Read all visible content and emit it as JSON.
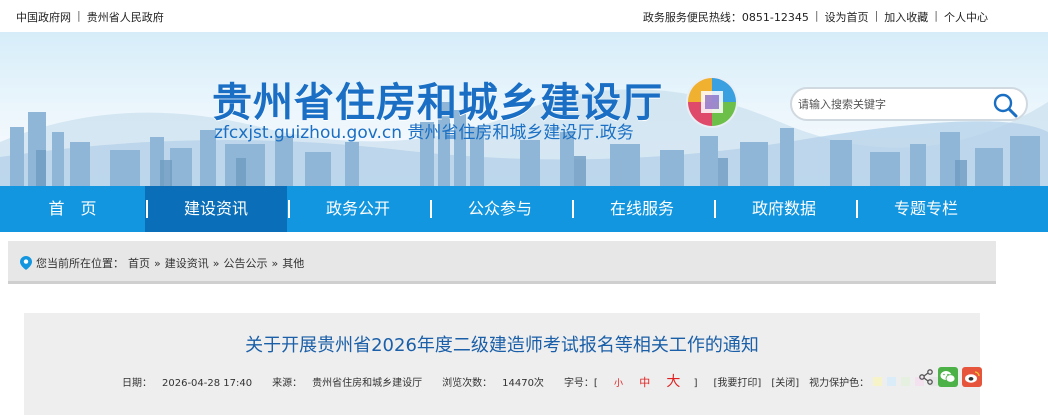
{
  "topbar": {
    "left_links": [
      "中国政府网",
      "贵州省人民政府"
    ],
    "hotline_label": "政务服务便民热线：",
    "hotline_number": "0851-12345",
    "right_links": [
      "设为首页",
      "加入收藏",
      "个人中心"
    ],
    "separator": "|"
  },
  "header": {
    "title": "贵州省住房和城乡建设厅",
    "subtitle": "zfcxjst.guizhou.gov.cn 贵州省住房和城乡建设厅.政务",
    "search_placeholder": "请输入搜索关键字"
  },
  "nav": {
    "items": [
      {
        "label": "首　页",
        "active": false
      },
      {
        "label": "建设资讯",
        "active": true
      },
      {
        "label": "政务公开",
        "active": false
      },
      {
        "label": "公众参与",
        "active": false
      },
      {
        "label": "在线服务",
        "active": false
      },
      {
        "label": "政府数据",
        "active": false
      },
      {
        "label": "专题专栏",
        "active": false
      }
    ]
  },
  "breadcrumb": {
    "prefix": "您当前所在位置：",
    "items": [
      "首页",
      "建设资讯",
      "公告公示",
      "其他"
    ],
    "separator": "»"
  },
  "article": {
    "title": "关于开展贵州省2026年度二级建造师考试报名等相关工作的通知",
    "date_label": "日期：",
    "date": "2026-04-28 17:40",
    "source_label": "来源：",
    "source": "贵州省住房和城乡建设厅",
    "views_label": "浏览次数：",
    "views": "14470次",
    "font_size_label": "字号：[",
    "font_small": "小",
    "font_mid": "中",
    "font_big": "大",
    "font_close": "]",
    "print": "[我要打印]",
    "close": "[关闭]",
    "eye_label": "视力保护色：",
    "swatches": [
      "#f7f3c8",
      "#d9ecf7",
      "#e6f0e0",
      "#f3e1f0",
      "#e6e6e6",
      "#ffffff"
    ]
  },
  "colors": {
    "nav_bg": "#1296e0",
    "nav_active": "#0a6fb8",
    "title_blue": "#1a6fc4",
    "wechat_green": "#4cb147",
    "weibo_red": "#e6543b"
  }
}
